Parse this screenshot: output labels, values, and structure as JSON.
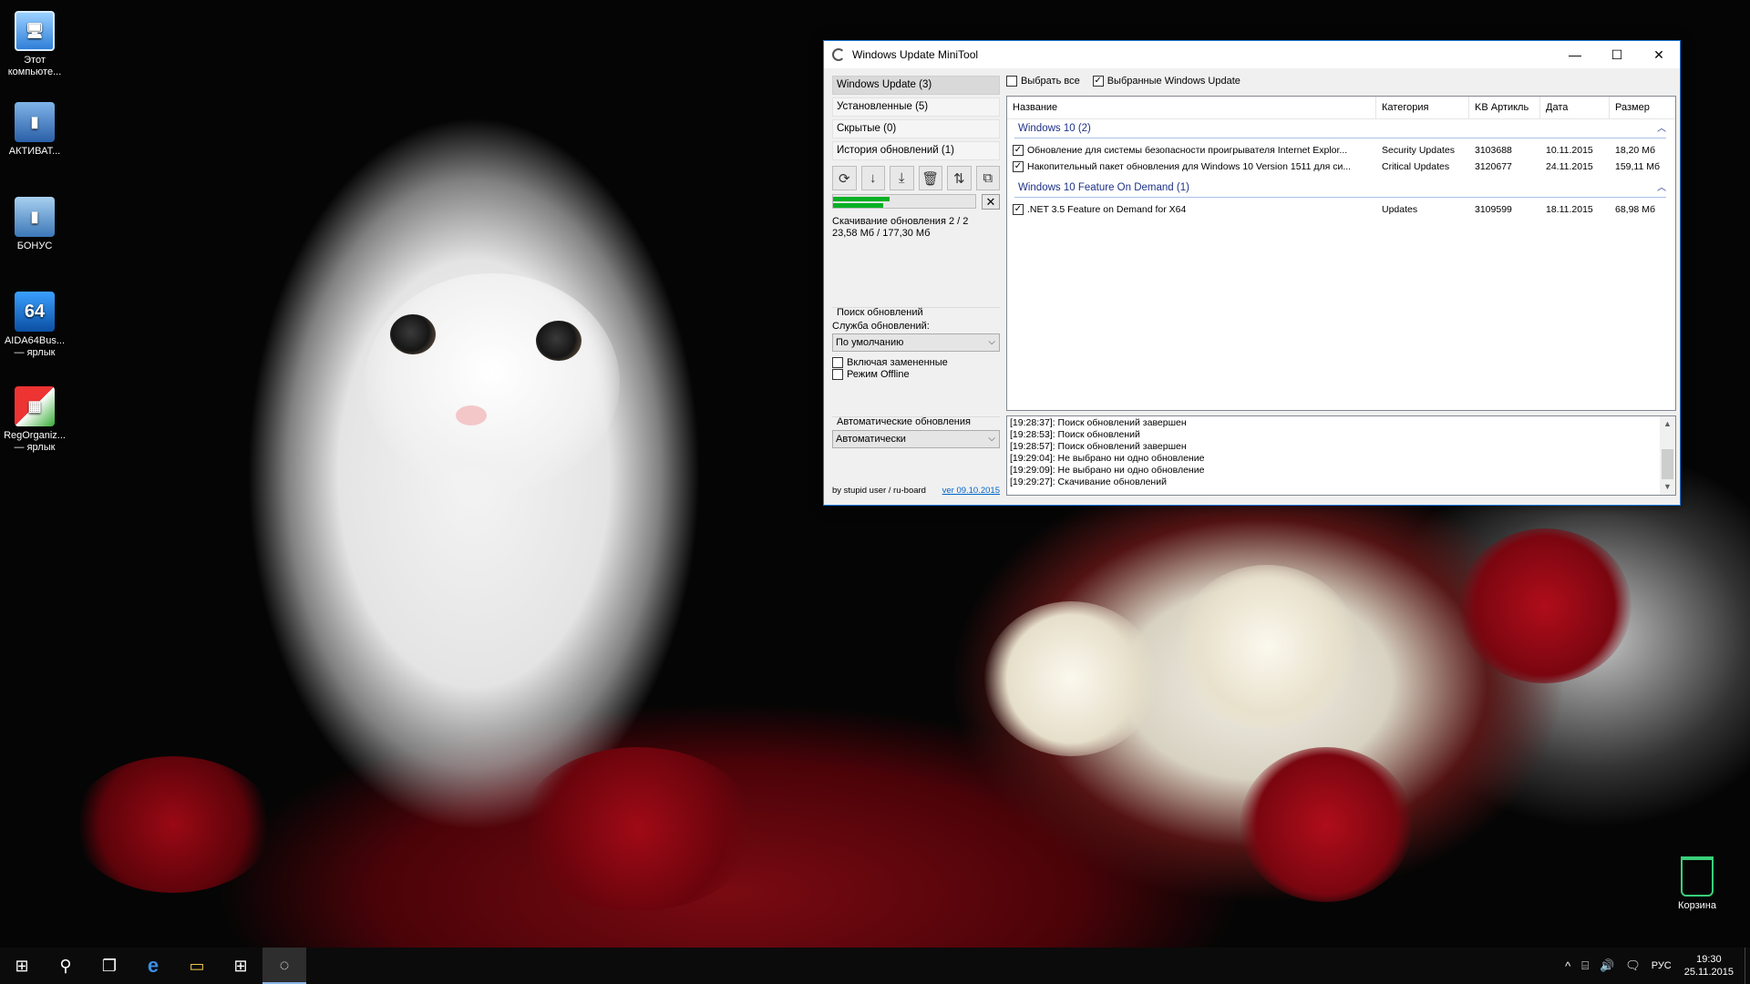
{
  "desktop": {
    "icons": [
      {
        "label": "Этот компьюте...",
        "icon": "computer-icon"
      },
      {
        "label": "АКТИВАТ...",
        "icon": "activator-icon"
      },
      {
        "label": "БОНУС",
        "icon": "bonus-icon"
      },
      {
        "label": "AIDA64Bus... — ярлык",
        "icon_text": "64",
        "icon": "aida64-icon"
      },
      {
        "label": "RegOrganiz... — ярлык",
        "icon": "regorganizer-icon"
      }
    ],
    "recycle_bin": {
      "label": "Корзина",
      "icon": "recycle-bin-icon"
    }
  },
  "window": {
    "title": "Windows Update MiniTool",
    "controls": {
      "minimize": "—",
      "maximize": "☐",
      "close": "✕"
    },
    "nav": [
      {
        "label": "Windows Update (3)",
        "active": true
      },
      {
        "label": "Установленные (5)",
        "active": false
      },
      {
        "label": "Скрытые (0)",
        "active": false
      },
      {
        "label": "История обновлений (1)",
        "active": false
      }
    ],
    "toolbar": [
      {
        "icon": "refresh-icon",
        "glyph": "⟳"
      },
      {
        "icon": "download-icon",
        "glyph": "↓"
      },
      {
        "icon": "install-icon",
        "glyph": "⤓"
      },
      {
        "icon": "delete-icon",
        "glyph": "🗑"
      },
      {
        "icon": "hide-icon",
        "glyph": "⇅"
      },
      {
        "icon": "copy-icon",
        "glyph": "⧉"
      }
    ],
    "progress": {
      "overall": 0.4,
      "current": 0.35,
      "cancel_glyph": "✕"
    },
    "status_line1": "Скачивание обновления 2 / 2",
    "status_line2": "23,58 Мб / 177,30 Мб",
    "search_group": {
      "title": "Поиск обновлений",
      "service_label": "Служба обновлений:",
      "service_value": "По умолчанию",
      "include_superseded": "Включая замененные",
      "offline_mode": "Режим Offline"
    },
    "auto_group": {
      "title": "Автоматические обновления",
      "value": "Автоматически"
    },
    "footer": {
      "author": "by stupid user / ru-board",
      "version": "ver 09.10.2015"
    },
    "select_all": "Выбрать все",
    "selected_wu": "Выбранные Windows Update",
    "columns": [
      "Название",
      "Категория",
      "KB Артикль",
      "Дата",
      "Размер"
    ],
    "groups": [
      {
        "title": "Windows 10 (2)",
        "rows": [
          {
            "name": "Обновление для системы безопасности проигрывателя Internet Explor...",
            "category": "Security Updates",
            "kb": "3103688",
            "date": "10.11.2015",
            "size": "18,20 Мб"
          },
          {
            "name": "Накопительный пакет обновления для Windows 10 Version 1511 для си...",
            "category": "Critical Updates",
            "kb": "3120677",
            "date": "24.11.2015",
            "size": "159,11 Мб"
          }
        ]
      },
      {
        "title": "Windows 10 Feature On Demand (1)",
        "rows": [
          {
            "name": ".NET 3.5 Feature on Demand for X64",
            "category": "Updates",
            "kb": "3109599",
            "date": "18.11.2015",
            "size": "68,98 Мб"
          }
        ]
      }
    ],
    "log": [
      "[19:28:37]: Поиск обновлений завершен",
      "[19:28:53]: Поиск обновлений",
      "[19:28:57]: Поиск обновлений завершен",
      "[19:29:04]: Не выбрано ни одно обновление",
      "[19:29:09]: Не выбрано ни одно обновление",
      "[19:29:27]: Скачивание обновлений"
    ]
  },
  "taskbar": {
    "items": [
      {
        "icon": "windows-start-icon",
        "glyph": "⊞"
      },
      {
        "icon": "search-icon",
        "glyph": "⚲"
      },
      {
        "icon": "task-view-icon",
        "glyph": "❐"
      },
      {
        "icon": "edge-icon",
        "glyph": "e"
      },
      {
        "icon": "file-explorer-icon",
        "glyph": "▭"
      },
      {
        "icon": "store-icon",
        "glyph": "⊞"
      },
      {
        "icon": "wu-minitool-taskbar-icon",
        "glyph": "◌",
        "active": true
      }
    ],
    "tray": {
      "icons": [
        "chevron-up-icon",
        "network-icon",
        "volume-icon",
        "action-center-icon"
      ],
      "glyphs": [
        "^",
        "⌸",
        "🔊",
        "🗨"
      ],
      "language": "РУС",
      "time": "19:30",
      "date": "25.11.2015"
    }
  }
}
